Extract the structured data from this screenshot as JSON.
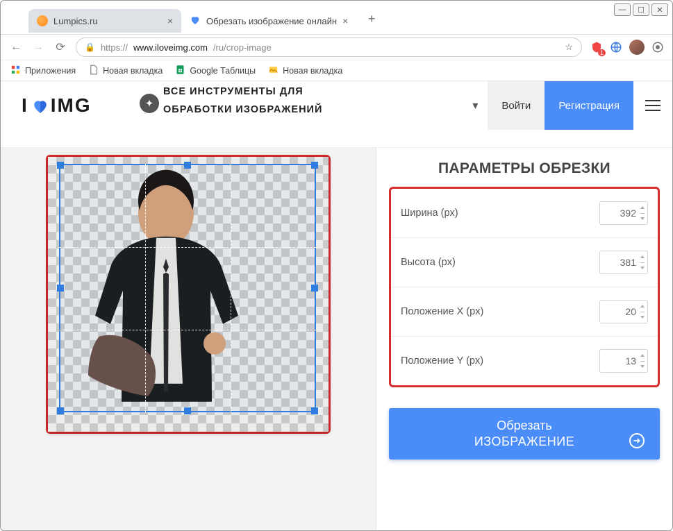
{
  "window": {
    "min": "—",
    "max": "☐",
    "close": "✕"
  },
  "tabs": {
    "tab1": {
      "title": "Lumpics.ru"
    },
    "tab2": {
      "title": "Обрезать изображение онлайн"
    }
  },
  "nav": {
    "url_proto": "https://",
    "url_host": "www.iloveimg.com",
    "url_path": "/ru/crop-image",
    "star": "☆"
  },
  "ext": {
    "badge": "1"
  },
  "bookmarks": {
    "apps": "Приложения",
    "new_tab_1": "Новая вкладка",
    "sheets": "Google Таблицы",
    "new_tab_2": "Новая вкладка"
  },
  "logo": {
    "prefix": "I",
    "suffix": "IMG"
  },
  "topbar": {
    "all_tools": "ВСЕ ИНСТРУМЕНТЫ ДЛЯ ОБРАБОТКИ ИЗОБРАЖЕНИЙ",
    "login": "Войти",
    "register": "Регистрация"
  },
  "panel": {
    "title": "ПАРАМЕТРЫ ОБРЕЗКИ",
    "width_label": "Ширина (px)",
    "width_value": "392",
    "height_label": "Высота (px)",
    "height_value": "381",
    "posx_label": "Положение X (px)",
    "posx_value": "20",
    "posy_label": "Положение Y (px)",
    "posy_value": "13"
  },
  "crop_btn": {
    "line1": "Обрезать",
    "line2": "ИЗОБРАЖЕНИЕ",
    "arrow": "➜"
  }
}
